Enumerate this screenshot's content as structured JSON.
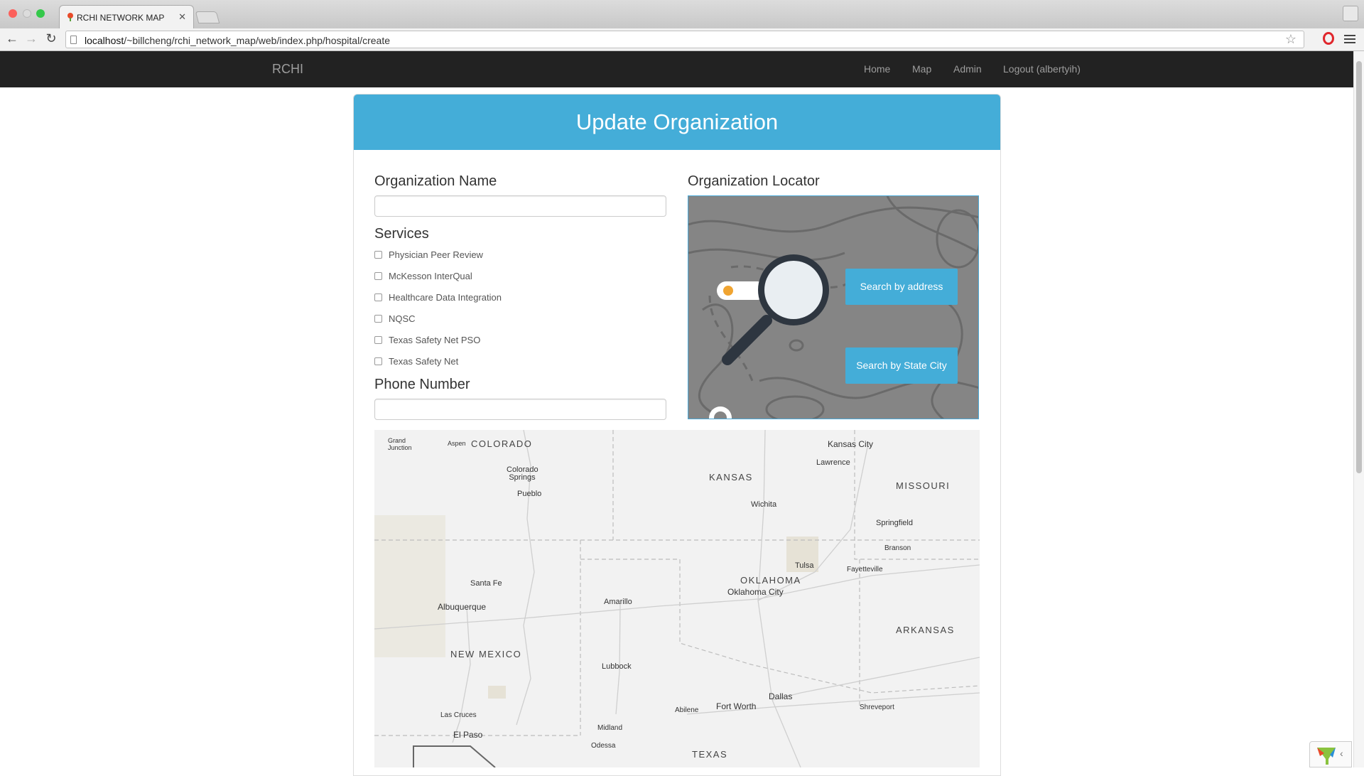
{
  "browser": {
    "tab_title": "RCHI NETWORK MAP",
    "url_host": "localhost",
    "url_path": "/~billcheng/rchi_network_map/web/index.php/hospital/create",
    "traffic_colors": [
      "#fc605b",
      "#fdbc40",
      "#34c84a"
    ]
  },
  "navbar": {
    "brand": "RCHI",
    "links": [
      "Home",
      "Map",
      "Admin",
      "Logout (albertyih)"
    ]
  },
  "panel": {
    "title": "Update Organization",
    "org_name_label": "Organization Name",
    "org_name_value": "",
    "services_label": "Services",
    "services": [
      "Physician Peer Review",
      "McKesson InterQual",
      "Healthcare Data Integration",
      "NQSC",
      "Texas Safety Net PSO",
      "Texas Safety Net"
    ],
    "phone_label": "Phone Number",
    "phone_value": "",
    "locator_label": "Organization Locator",
    "search_address": "Search by address",
    "search_state_city": "Search by State City"
  },
  "map": {
    "states": [
      "COLORADO",
      "KANSAS",
      "MISSOURI",
      "OKLAHOMA",
      "ARKANSAS",
      "NEW MEXICO",
      "TEXAS"
    ],
    "cities": [
      "Grand Junction",
      "Aspen",
      "Colorado Springs",
      "Pueblo",
      "Kansas City",
      "Lawrence",
      "Wichita",
      "Springfield",
      "Branson",
      "Tulsa",
      "Fayetteville",
      "Oklahoma City",
      "Santa Fe",
      "Albuquerque",
      "Amarillo",
      "Lubbock",
      "Abilene",
      "Fort Worth",
      "Dallas",
      "Shreveport",
      "Las Cruces",
      "El Paso",
      "Midland",
      "Odessa"
    ]
  },
  "colors": {
    "accent": "#44add8",
    "navbar": "#222222"
  }
}
